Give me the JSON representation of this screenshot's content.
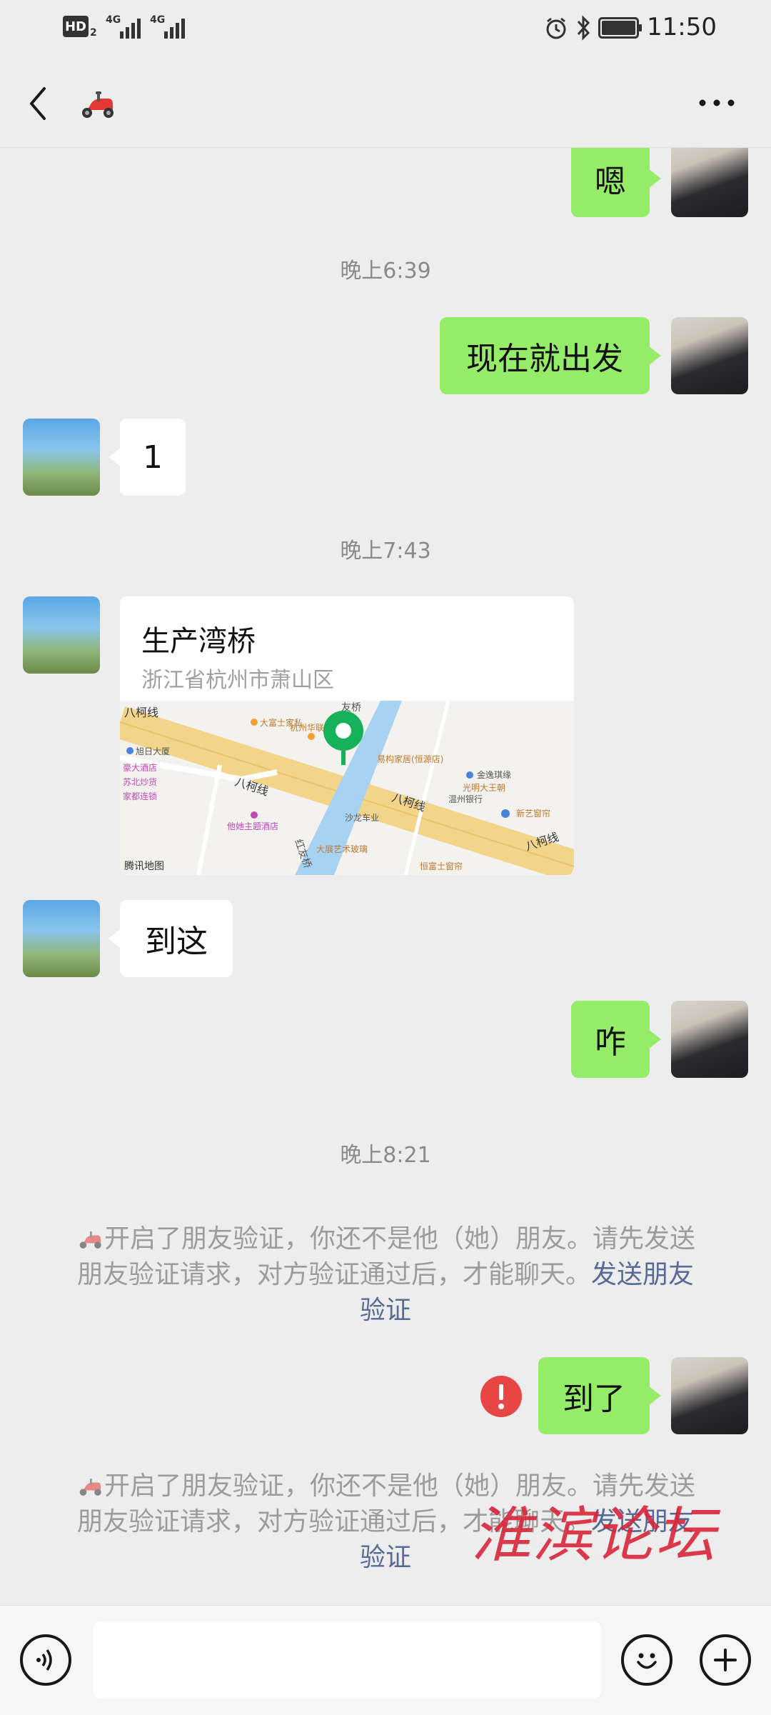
{
  "status_bar": {
    "hd_label": "HD",
    "hd_sub": "2",
    "signal1_label": "4G",
    "signal2_label": "4G",
    "time": "11:50",
    "icons": [
      "alarm-icon",
      "bluetooth-icon",
      "battery-icon"
    ]
  },
  "header": {
    "back_icon": "chevron-left-icon",
    "contact_icon": "scooter-emoji-icon",
    "menu_icon": "more-dots-icon"
  },
  "messages": [
    {
      "id": "m1",
      "side": "right",
      "type": "text",
      "text": "嗯"
    },
    {
      "id": "t1",
      "type": "timestamp",
      "text": "晚上6:39"
    },
    {
      "id": "m2",
      "side": "right",
      "type": "text",
      "text": "现在就出发"
    },
    {
      "id": "m3",
      "side": "left",
      "type": "text",
      "text": "1"
    },
    {
      "id": "t2",
      "type": "timestamp",
      "text": "晚上7:43"
    },
    {
      "id": "m4",
      "side": "left",
      "type": "location",
      "title": "生产湾桥",
      "address": "浙江省杭州市萧山区"
    },
    {
      "id": "m5",
      "side": "left",
      "type": "text",
      "text": "到这"
    },
    {
      "id": "m6",
      "side": "right",
      "type": "text",
      "text": "咋"
    },
    {
      "id": "t3",
      "type": "timestamp",
      "text": "晚上8:21"
    },
    {
      "id": "s1",
      "type": "system",
      "text": "开启了朋友验证，你还不是他（她）朋友。请先发送朋友验证请求，对方验证通过后，才能聊天。",
      "link": "发送朋友验证"
    },
    {
      "id": "m7",
      "side": "right",
      "type": "text",
      "text": "到了",
      "failed": true
    },
    {
      "id": "s2",
      "type": "system",
      "text": "开启了朋友验证，你还不是他（她）朋友。请先发送朋友验证请求，对方验证通过后，才能聊天。",
      "link": "发送朋友验证"
    }
  ],
  "map": {
    "road_top": "八柯线",
    "road_mid_left": "八柯线",
    "road_mid": "八柯线",
    "road_right": "八柯线",
    "bridge_top": "友桥",
    "bridge_bottom": "红友桥",
    "poi": [
      "大富士家私",
      "杭州华联",
      "旭日大厦",
      "豪大酒店",
      "苏北炒货",
      "家都连锁",
      "他她主题酒店",
      "易构家居(恒源店)",
      "金逸琪缘",
      "光明大王朝",
      "温州银行",
      "新艺窗帘",
      "沙龙车业",
      "大展艺术玻璃",
      "恒富士窗帘"
    ],
    "attribution": "腾讯地图",
    "pin_color": "#15b25a"
  },
  "input_bar": {
    "voice_icon": "voice-icon",
    "emoji_icon": "emoji-icon",
    "plus_icon": "plus-icon",
    "input_value": ""
  },
  "watermark": "淮滨论坛",
  "colors": {
    "bubble_self": "#95ec69",
    "bubble_peer": "#ffffff",
    "link": "#576b95",
    "error": "#e84545"
  }
}
